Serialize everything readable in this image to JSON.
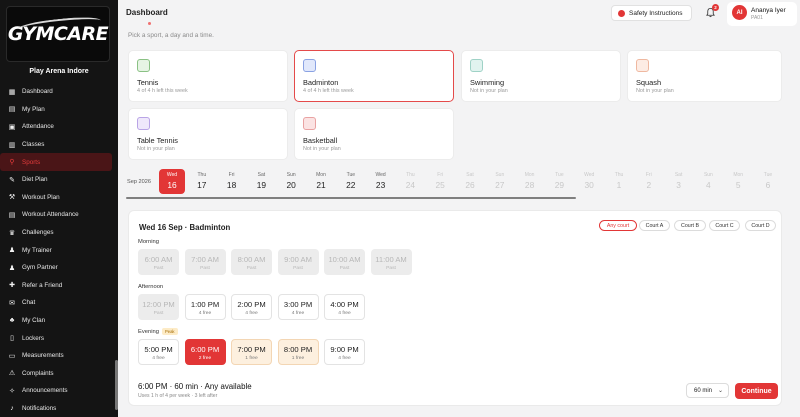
{
  "sidebar": {
    "logo_text": "GYMCARE",
    "venue": "Play Arena Indore",
    "items": [
      {
        "label": "Dashboard",
        "icon": "dashboard-icon",
        "glyph": "▦"
      },
      {
        "label": "My Plan",
        "icon": "plan-icon",
        "glyph": "▤"
      },
      {
        "label": "Attendance",
        "icon": "attendance-icon",
        "glyph": "▣"
      },
      {
        "label": "Classes",
        "icon": "classes-icon",
        "glyph": "▥"
      },
      {
        "label": "Sports",
        "icon": "sports-icon",
        "glyph": "⚲",
        "active": true
      },
      {
        "label": "Diet Plan",
        "icon": "diet-icon",
        "glyph": "✎"
      },
      {
        "label": "Workout Plan",
        "icon": "workout-icon",
        "glyph": "⚒"
      },
      {
        "label": "Workout Attendance",
        "icon": "workout-attendance-icon",
        "glyph": "▤"
      },
      {
        "label": "Challenges",
        "icon": "trophy-icon",
        "glyph": "♛"
      },
      {
        "label": "My Trainer",
        "icon": "trainer-icon",
        "glyph": "♟"
      },
      {
        "label": "Gym Partner",
        "icon": "partner-icon",
        "glyph": "♟"
      },
      {
        "label": "Refer a Friend",
        "icon": "refer-icon",
        "glyph": "✚"
      },
      {
        "label": "Chat",
        "icon": "chat-icon",
        "glyph": "✉"
      },
      {
        "label": "My Clan",
        "icon": "clan-icon",
        "glyph": "♣"
      },
      {
        "label": "Lockers",
        "icon": "locker-icon",
        "glyph": "▯"
      },
      {
        "label": "Measurements",
        "icon": "measure-icon",
        "glyph": "▭"
      },
      {
        "label": "Complaints",
        "icon": "complaint-icon",
        "glyph": "⚠"
      },
      {
        "label": "Announcements",
        "icon": "announce-icon",
        "glyph": "✧"
      },
      {
        "label": "Notifications",
        "icon": "notification-icon",
        "glyph": "♪"
      }
    ]
  },
  "header": {
    "title": "Dashboard",
    "safety_label": "Safety Instructions",
    "notification_count": "2",
    "user_initials": "AI",
    "user_name": "Ananya Iyer",
    "user_sub": "PA01"
  },
  "subtitle": "Pick a sport, a day and a time.",
  "sports": [
    {
      "name": "Tennis",
      "sub": "4 of 4 h left this week",
      "color": "#e6f4e4",
      "border": "#8ac184"
    },
    {
      "name": "Badminton",
      "sub": "4 of 4 h left this week",
      "color": "#e1e8fb",
      "border": "#8aa2e3",
      "selected": true
    },
    {
      "name": "Swimming",
      "sub": "Not in your plan",
      "color": "#e1f3ef",
      "border": "#9fd2c6"
    },
    {
      "name": "Squash",
      "sub": "Not in your plan",
      "color": "#fdece4",
      "border": "#efb8a0"
    },
    {
      "name": "Table Tennis",
      "sub": "Not in your plan",
      "color": "#efe8fb",
      "border": "#b9a4e6"
    },
    {
      "name": "Basketball",
      "sub": "Not in your plan",
      "color": "#fbe3e3",
      "border": "#e9a2a2"
    }
  ],
  "month_label": "Sep 2026",
  "days": [
    {
      "dw": "Wed",
      "dn": "16",
      "state": "selected"
    },
    {
      "dw": "Thu",
      "dn": "17",
      "state": "normal"
    },
    {
      "dw": "Fri",
      "dn": "18",
      "state": "normal"
    },
    {
      "dw": "Sat",
      "dn": "19",
      "state": "normal"
    },
    {
      "dw": "Sun",
      "dn": "20",
      "state": "normal"
    },
    {
      "dw": "Mon",
      "dn": "21",
      "state": "normal"
    },
    {
      "dw": "Tue",
      "dn": "22",
      "state": "normal"
    },
    {
      "dw": "Wed",
      "dn": "23",
      "state": "normal"
    },
    {
      "dw": "Thu",
      "dn": "24",
      "state": "faded"
    },
    {
      "dw": "Fri",
      "dn": "25",
      "state": "faded"
    },
    {
      "dw": "Sat",
      "dn": "26",
      "state": "faded"
    },
    {
      "dw": "Sun",
      "dn": "27",
      "state": "faded"
    },
    {
      "dw": "Mon",
      "dn": "28",
      "state": "faded"
    },
    {
      "dw": "Tue",
      "dn": "29",
      "state": "faded"
    },
    {
      "dw": "Wed",
      "dn": "30",
      "state": "faded"
    },
    {
      "dw": "Thu",
      "dn": "1",
      "state": "faded"
    },
    {
      "dw": "Fri",
      "dn": "2",
      "state": "faded"
    },
    {
      "dw": "Sat",
      "dn": "3",
      "state": "faded"
    },
    {
      "dw": "Sun",
      "dn": "4",
      "state": "faded"
    },
    {
      "dw": "Mon",
      "dn": "5",
      "state": "faded"
    },
    {
      "dw": "Tue",
      "dn": "6",
      "state": "faded"
    }
  ],
  "panel": {
    "title": "Wed 16 Sep · Badminton",
    "courts": [
      {
        "label": "Any court",
        "active": true
      },
      {
        "label": "Court A"
      },
      {
        "label": "Court B"
      },
      {
        "label": "Court C"
      },
      {
        "label": "Court D"
      }
    ],
    "morning_label": "Morning",
    "afternoon_label": "Afternoon",
    "evening_label": "Evening",
    "peak_label": "Peak",
    "morning": [
      {
        "time": "6:00 AM",
        "sub": "Past",
        "state": "past"
      },
      {
        "time": "7:00 AM",
        "sub": "Past",
        "state": "past"
      },
      {
        "time": "8:00 AM",
        "sub": "Past",
        "state": "past"
      },
      {
        "time": "9:00 AM",
        "sub": "Past",
        "state": "past"
      },
      {
        "time": "10:00 AM",
        "sub": "Past",
        "state": "past"
      },
      {
        "time": "11:00 AM",
        "sub": "Past",
        "state": "past"
      }
    ],
    "afternoon": [
      {
        "time": "12:00 PM",
        "sub": "Past",
        "state": "past"
      },
      {
        "time": "1:00 PM",
        "sub": "4 free",
        "state": "normal"
      },
      {
        "time": "2:00 PM",
        "sub": "4 free",
        "state": "normal"
      },
      {
        "time": "3:00 PM",
        "sub": "4 free",
        "state": "normal"
      },
      {
        "time": "4:00 PM",
        "sub": "4 free",
        "state": "normal"
      }
    ],
    "evening": [
      {
        "time": "5:00 PM",
        "sub": "4 free",
        "state": "normal"
      },
      {
        "time": "6:00 PM",
        "sub": "2 free",
        "state": "selected"
      },
      {
        "time": "7:00 PM",
        "sub": "1 free",
        "state": "peak"
      },
      {
        "time": "8:00 PM",
        "sub": "1 free",
        "state": "peak"
      },
      {
        "time": "9:00 PM",
        "sub": "4 free",
        "state": "normal"
      }
    ],
    "summary": "6:00 PM · 60 min · Any available",
    "summary_sub": "Uses 1 h of 4 per week · 3 left after",
    "duration": "60 min",
    "continue_label": "Continue"
  },
  "colors": {
    "accent": "#e23636",
    "sidebar_bg": "#141414"
  }
}
